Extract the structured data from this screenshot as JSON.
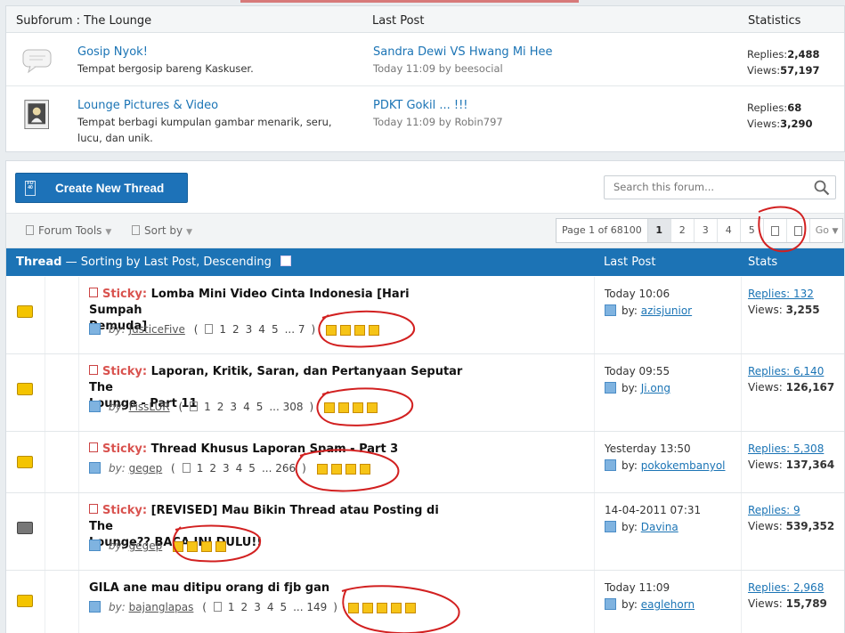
{
  "subforum_header": {
    "title": "Subforum : The Lounge",
    "last_post": "Last Post",
    "statistics": "Statistics"
  },
  "subforums": [
    {
      "icon": "speech-bubble-icon",
      "title": "Gosip Nyok!",
      "desc": "Tempat bergosip bareng Kaskuser.",
      "last_title": "Sandra Dewi VS Hwang Mi Hee",
      "last_time": "Today 11:09",
      "last_by_prefix": "by",
      "last_by": "beesocial",
      "replies_label": "Replies:",
      "replies": "2,488",
      "views_label": "Views:",
      "views": "57,197"
    },
    {
      "icon": "picture-icon",
      "title": "Lounge Pictures & Video",
      "desc": "Tempat berbagi kumpulan gambar menarik, seru, lucu, dan unik.",
      "last_title": "PDKT Gokil ... !!!",
      "last_time": "Today 11:09",
      "last_by_prefix": "by",
      "last_by": "Robin797",
      "replies_label": "Replies:",
      "replies": "68",
      "views_label": "Views:",
      "views": "3,290"
    }
  ],
  "create_thread": "Create New Thread",
  "create_icon_text": "FO\n40",
  "search_placeholder": "Search this forum...",
  "toolbar": {
    "forum_tools": "Forum Tools",
    "sort_by": "Sort by"
  },
  "pager": {
    "info": "Page 1 of 68100",
    "pages": [
      "1",
      "2",
      "3",
      "4",
      "5"
    ],
    "go": "Go"
  },
  "thread_header": {
    "thread": "Thread",
    "sorting_prefix": " — Sorting by ",
    "sort_field": "Last Post",
    "sort_sep": ", ",
    "sort_dir": "Descending",
    "last_post": "Last Post",
    "stats": "Stats"
  },
  "labels": {
    "sticky": "Sticky:",
    "by_italic": "by:",
    "by": "by:",
    "replies": "Replies: ",
    "views": "Views: "
  },
  "threads": [
    {
      "sticky": true,
      "locked": false,
      "title_line1": "Lomba Mini Video Cinta Indonesia [Hari Sumpah",
      "title_line2": "Pemuda]",
      "author": "JusticeFive",
      "pages": [
        "1",
        "2",
        "3",
        "4",
        "5",
        "... 7"
      ],
      "rating_stars": 4,
      "last_date": "Today 10:06",
      "last_by": "azisjunior",
      "replies": "132",
      "views": "3,255"
    },
    {
      "sticky": true,
      "locked": false,
      "title_line1": "Laporan, Kritik, Saran, dan Pertanyaan Seputar The",
      "title_line2": "Lounge - Part 11",
      "author": "PissLUR",
      "pages": [
        "1",
        "2",
        "3",
        "4",
        "5",
        "... 308"
      ],
      "rating_stars": 4,
      "last_date": "Today 09:55",
      "last_by": "Ji.ong",
      "replies": "6,140",
      "views": "126,167"
    },
    {
      "sticky": true,
      "locked": false,
      "title_line1": "Thread Khusus Laporan Spam - Part 3",
      "title_line2": "",
      "author": "gegep",
      "pages": [
        "1",
        "2",
        "3",
        "4",
        "5",
        "... 266"
      ],
      "rating_stars": 4,
      "last_date": "Yesterday 13:50",
      "last_by": "pokokembanyol",
      "replies": "5,308",
      "views": "137,364"
    },
    {
      "sticky": true,
      "locked": true,
      "title_line1": "[REVISED] Mau Bikin Thread atau Posting di The",
      "title_line2": "Lounge?? BACA INI DULU!!",
      "author": "gegep",
      "pages": [],
      "rating_stars": 4,
      "last_date": "14-04-2011 07:31",
      "last_by": "Davina",
      "replies": "9",
      "views": "539,352"
    },
    {
      "sticky": false,
      "locked": false,
      "title_line1": "GILA ane mau ditipu orang di fjb gan",
      "title_line2": "",
      "author": "bajanglapas",
      "pages": [
        "1",
        "2",
        "3",
        "4",
        "5",
        "... 149"
      ],
      "rating_stars": 5,
      "last_date": "Today 11:09",
      "last_by": "eaglehorn",
      "replies": "2,968",
      "views": "15,789"
    }
  ],
  "colors": {
    "brand_blue": "#1c73b5",
    "link_blue": "#1b74b5",
    "sticky_red": "#d9534f",
    "annotation_red": "#d22020",
    "star_gold": "#f6c417"
  }
}
